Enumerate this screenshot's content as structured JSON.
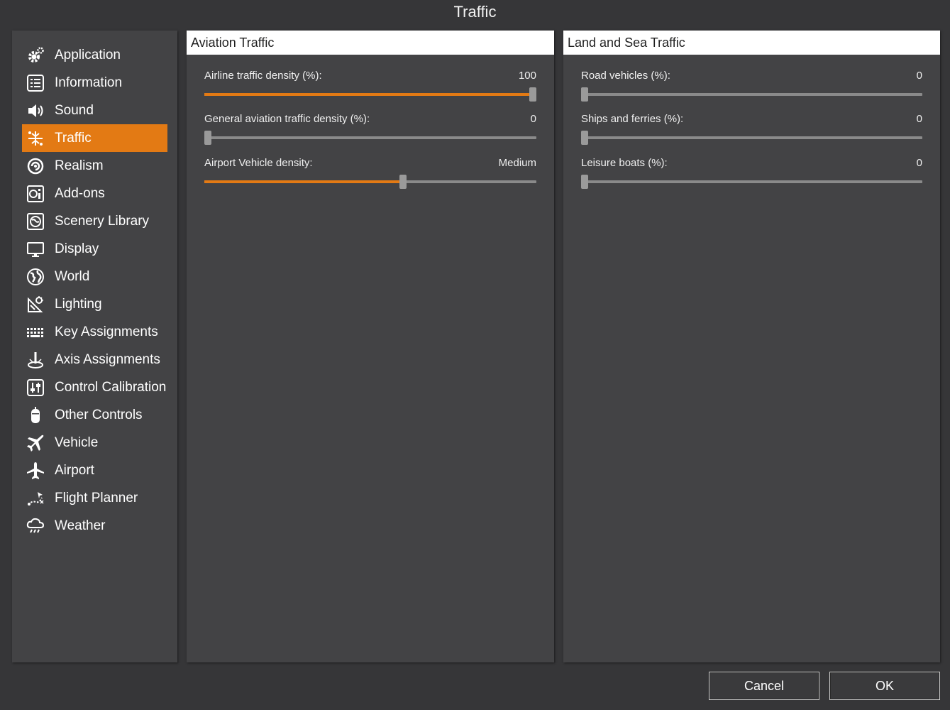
{
  "window": {
    "title": "Traffic"
  },
  "sidebar": {
    "items": [
      {
        "label": "Application",
        "icon": "gear-icon"
      },
      {
        "label": "Information",
        "icon": "list-icon"
      },
      {
        "label": "Sound",
        "icon": "speaker-icon"
      },
      {
        "label": "Traffic",
        "icon": "traffic-icon",
        "selected": true
      },
      {
        "label": "Realism",
        "icon": "realism-icon"
      },
      {
        "label": "Add-ons",
        "icon": "addons-icon"
      },
      {
        "label": "Scenery Library",
        "icon": "scenery-icon"
      },
      {
        "label": "Display",
        "icon": "monitor-icon"
      },
      {
        "label": "World",
        "icon": "globe-icon"
      },
      {
        "label": "Lighting",
        "icon": "lighting-icon"
      },
      {
        "label": "Key Assignments",
        "icon": "keyboard-icon"
      },
      {
        "label": "Axis Assignments",
        "icon": "joystick-icon"
      },
      {
        "label": "Control Calibration",
        "icon": "calibration-icon"
      },
      {
        "label": "Other Controls",
        "icon": "controller-icon"
      },
      {
        "label": "Vehicle",
        "icon": "plane-icon"
      },
      {
        "label": "Airport",
        "icon": "airport-icon"
      },
      {
        "label": "Flight Planner",
        "icon": "flight-planner-icon"
      },
      {
        "label": "Weather",
        "icon": "weather-icon"
      }
    ]
  },
  "aviation": {
    "header": "Aviation Traffic",
    "settings": [
      {
        "label": "Airline traffic density (%):",
        "value": "100",
        "fraction": 1.0
      },
      {
        "label": "General aviation traffic density (%):",
        "value": "0",
        "fraction": 0.0
      },
      {
        "label": "Airport Vehicle density:",
        "value": "Medium",
        "fraction": 0.6
      }
    ]
  },
  "land_sea": {
    "header": "Land and Sea Traffic",
    "settings": [
      {
        "label": "Road vehicles (%):",
        "value": "0",
        "fraction": 0.0
      },
      {
        "label": "Ships and ferries (%):",
        "value": "0",
        "fraction": 0.0
      },
      {
        "label": "Leisure boats (%):",
        "value": "0",
        "fraction": 0.0
      }
    ]
  },
  "buttons": {
    "cancel": "Cancel",
    "ok": "OK"
  },
  "colors": {
    "accent": "#e37a14",
    "panel": "#434345",
    "background": "#363638"
  }
}
